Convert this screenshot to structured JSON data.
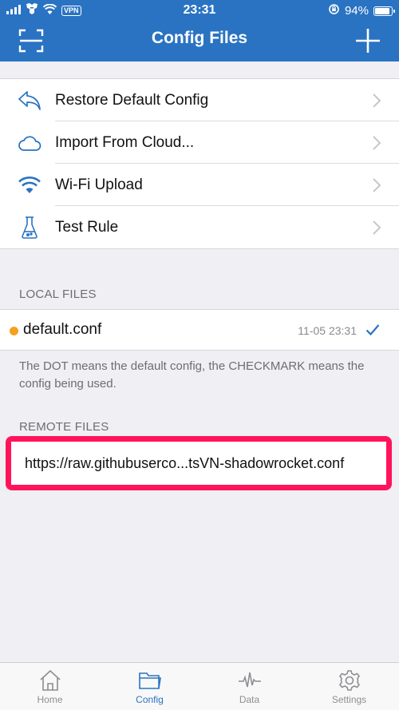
{
  "status_bar": {
    "vpn": "VPN",
    "time": "23:31",
    "battery": "94%",
    "battery_level": 0.94
  },
  "nav": {
    "title": "Config Files",
    "left_icon": "scan-icon",
    "right_icon": "plus-icon"
  },
  "menu": [
    {
      "label": "Restore Default Config",
      "icon": "undo-arrow-icon"
    },
    {
      "label": "Import From Cloud...",
      "icon": "cloud-icon"
    },
    {
      "label": "Wi-Fi Upload",
      "icon": "wifi-icon"
    },
    {
      "label": "Test Rule",
      "icon": "flask-icon"
    }
  ],
  "local_files": {
    "header": "LOCAL FILES",
    "files": [
      {
        "name": "default.conf",
        "time": "11-05 23:31",
        "is_default": true,
        "in_use": true
      }
    ],
    "note": "The DOT means the default config, the CHECKMARK means the config being used."
  },
  "remote_files": {
    "header": "REMOTE FILES",
    "files": [
      {
        "url": "https://raw.githubuserco...tsVN-shadowrocket.conf"
      }
    ]
  },
  "tabs": [
    {
      "label": "Home",
      "icon": "home-icon",
      "active": false
    },
    {
      "label": "Config",
      "icon": "folder-icon",
      "active": true
    },
    {
      "label": "Data",
      "icon": "pulse-icon",
      "active": false
    },
    {
      "label": "Settings",
      "icon": "gear-icon",
      "active": false
    }
  ],
  "colors": {
    "accent": "#2a73c2",
    "highlight": "#ff145c",
    "default_dot": "#f5a11f"
  }
}
